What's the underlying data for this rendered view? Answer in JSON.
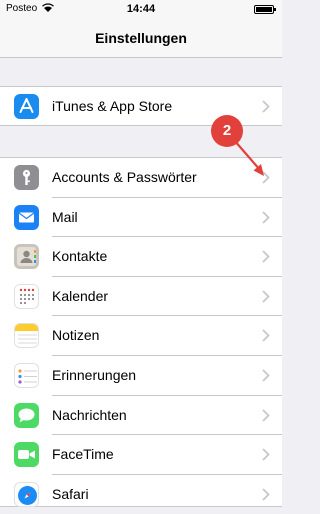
{
  "status": {
    "carrier": "Posteo",
    "time": "14:44"
  },
  "nav": {
    "title": "Einstellungen"
  },
  "group1": [
    {
      "label": "iTunes & App Store",
      "icon": "app-store-icon"
    }
  ],
  "group2": [
    {
      "label": "Accounts & Passwörter",
      "icon": "key-icon"
    },
    {
      "label": "Mail",
      "icon": "mail-icon"
    },
    {
      "label": "Kontakte",
      "icon": "contacts-icon"
    },
    {
      "label": "Kalender",
      "icon": "calendar-icon"
    },
    {
      "label": "Notizen",
      "icon": "notes-icon"
    },
    {
      "label": "Erinnerungen",
      "icon": "reminders-icon"
    },
    {
      "label": "Nachrichten",
      "icon": "messages-icon"
    },
    {
      "label": "FaceTime",
      "icon": "facetime-icon"
    },
    {
      "label": "Safari",
      "icon": "safari-icon"
    }
  ],
  "callout": {
    "number": "2",
    "color": "#e2403a"
  }
}
